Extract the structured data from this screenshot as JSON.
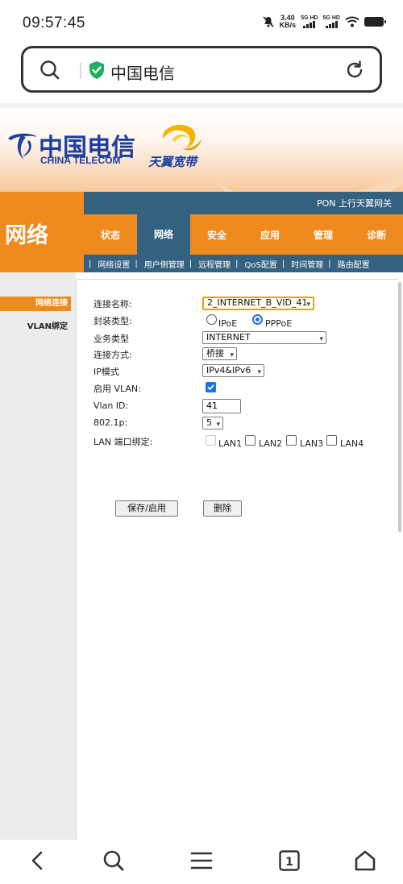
{
  "status_bar": {
    "time": "09:57:45",
    "net_speed_value": "3.40",
    "net_speed_unit": "KB/s",
    "sim1_label": "5G HD",
    "sim2_label": "5G HD"
  },
  "browser": {
    "url_text": "中国电信"
  },
  "banner": {
    "brand_cn": "中国电信",
    "brand_en": "CHINA TELECOM",
    "product": "天翼宽带"
  },
  "router": {
    "section_title": "网络",
    "strip_text": "PON 上行天翼网关",
    "menu": [
      {
        "label": "状态",
        "active": false
      },
      {
        "label": "网络",
        "active": true
      },
      {
        "label": "安全",
        "active": false
      },
      {
        "label": "应用",
        "active": false
      },
      {
        "label": "管理",
        "active": false
      },
      {
        "label": "诊断",
        "active": false
      }
    ],
    "submenu": [
      "网络设置",
      "用户侧管理",
      "远程管理",
      "QoS配置",
      "时间管理",
      "路由配置"
    ],
    "sidebar": [
      {
        "label": "网络连接",
        "active": true
      },
      {
        "label": "VLAN绑定",
        "active": false
      }
    ]
  },
  "form": {
    "connection_name_label": "连接名称:",
    "connection_name_value": "2_INTERNET_B_VID_41",
    "encapsulation_label": "封装类型:",
    "encapsulation_options": [
      "IPoE",
      "PPPoE"
    ],
    "encapsulation_selected": "PPPoE",
    "service_type_label": "业务类型",
    "service_type_value": "INTERNET",
    "connection_mode_label": "连接方式:",
    "connection_mode_value": "桥接",
    "ip_mode_label": "IP模式",
    "ip_mode_value": "IPv4&IPv6",
    "enable_vlan_label": "启用 VLAN:",
    "enable_vlan_checked": true,
    "vlan_id_label": "Vlan ID:",
    "vlan_id_value": "41",
    "dot1p_label": "802.1p:",
    "dot1p_value": "5",
    "lan_bind_label": "LAN 端口绑定:",
    "lan_ports": [
      "LAN1",
      "LAN2",
      "LAN3",
      "LAN4"
    ],
    "save_button": "保存/启用",
    "delete_button": "删除"
  },
  "colors": {
    "orange": "#ef8a1f",
    "navy": "#346180",
    "brand_blue": "#1c3fa0",
    "check_blue": "#1a73e8"
  }
}
